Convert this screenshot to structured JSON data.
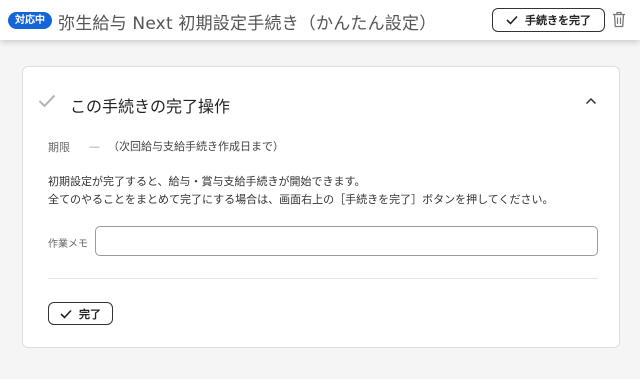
{
  "header": {
    "status_badge": "対応中",
    "title": "弥生給与 Next 初期設定手続き（かんたん設定）",
    "complete_button": "手続きを完了",
    "delete_icon": "trash-icon"
  },
  "panel": {
    "title": "この手続きの完了操作",
    "deadline_label": "期限",
    "deadline_dash": "—",
    "deadline_value": "（次回給与支給手続き作成日まで）",
    "description_line1": "初期設定が完了すると、給与・賞与支給手続きが開始できます。",
    "description_line2": "全てのやることをまとめて完了にする場合は、画面右上の［手続きを完了］ボタンを押してください。",
    "memo_label": "作業メモ",
    "memo_value": "",
    "done_button": "完了"
  },
  "colors": {
    "badge": "#1565d8",
    "check_muted": "#b5b5b5",
    "text_primary": "#222222"
  }
}
